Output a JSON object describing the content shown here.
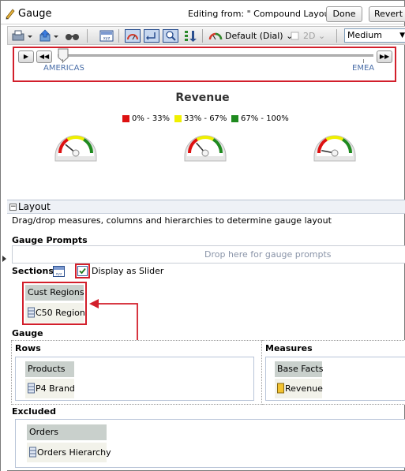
{
  "header": {
    "title": "Gauge",
    "editing_label": "Editing from: \" Compound Layout\"",
    "done_label": "Done",
    "revert_label": "Revert"
  },
  "toolbar": {
    "dial_label": "Default (Dial)",
    "twod_label": "2D",
    "size_value": "Medium",
    "icons": [
      "print-icon",
      "export-icon",
      "view-icon",
      "xyz-icon",
      "gauge-icon",
      "return-icon",
      "zoom-icon",
      "sort-icon",
      "dial-icon",
      "2d-icon"
    ]
  },
  "slider": {
    "start_label": "AMERICAS",
    "end_label": "EMEA",
    "position": 0
  },
  "chart": {
    "title": "Revenue",
    "legend": [
      {
        "label": "0% - 33%",
        "color": "#dd1111"
      },
      {
        "label": "33% - 67%",
        "color": "#f0f000"
      },
      {
        "label": "67% - 100%",
        "color": "#1f8a1f"
      }
    ]
  },
  "chart_data": {
    "type": "gauge",
    "title": "Revenue",
    "ranges": [
      {
        "label": "0% - 33%",
        "color": "#dd1111",
        "from": 0,
        "to": 33
      },
      {
        "label": "33% - 67%",
        "color": "#f0f000",
        "from": 33,
        "to": 67
      },
      {
        "label": "67% - 100%",
        "color": "#1f8a1f",
        "from": 67,
        "to": 100
      }
    ],
    "gauges": [
      {
        "needle_pct": 22
      },
      {
        "needle_pct": 27
      },
      {
        "needle_pct": 6
      }
    ]
  },
  "layout": {
    "title": "Layout",
    "instructions": "Drag/drop measures, columns and hierarchies to determine gauge layout",
    "gauge_prompts": {
      "title": "Gauge Prompts",
      "drop_hint": "Drop here for gauge prompts"
    },
    "sections": {
      "title": "Sections",
      "checkbox_label": "Display as Slider",
      "checked": true,
      "column_header": "Cust Regions",
      "item": "C50 Region"
    },
    "gauge": {
      "title": "Gauge",
      "rows": {
        "title": "Rows",
        "column_header": "Products",
        "item": "P4 Brand"
      },
      "measures": {
        "title": "Measures",
        "column_header": "Base Facts",
        "item": "Revenue"
      }
    },
    "excluded": {
      "title": "Excluded",
      "column_header": "Orders",
      "item": "Orders Hierarchy"
    }
  },
  "colors": {
    "highlight": "#d21f2b",
    "axis_label": "#4a6ea8"
  }
}
